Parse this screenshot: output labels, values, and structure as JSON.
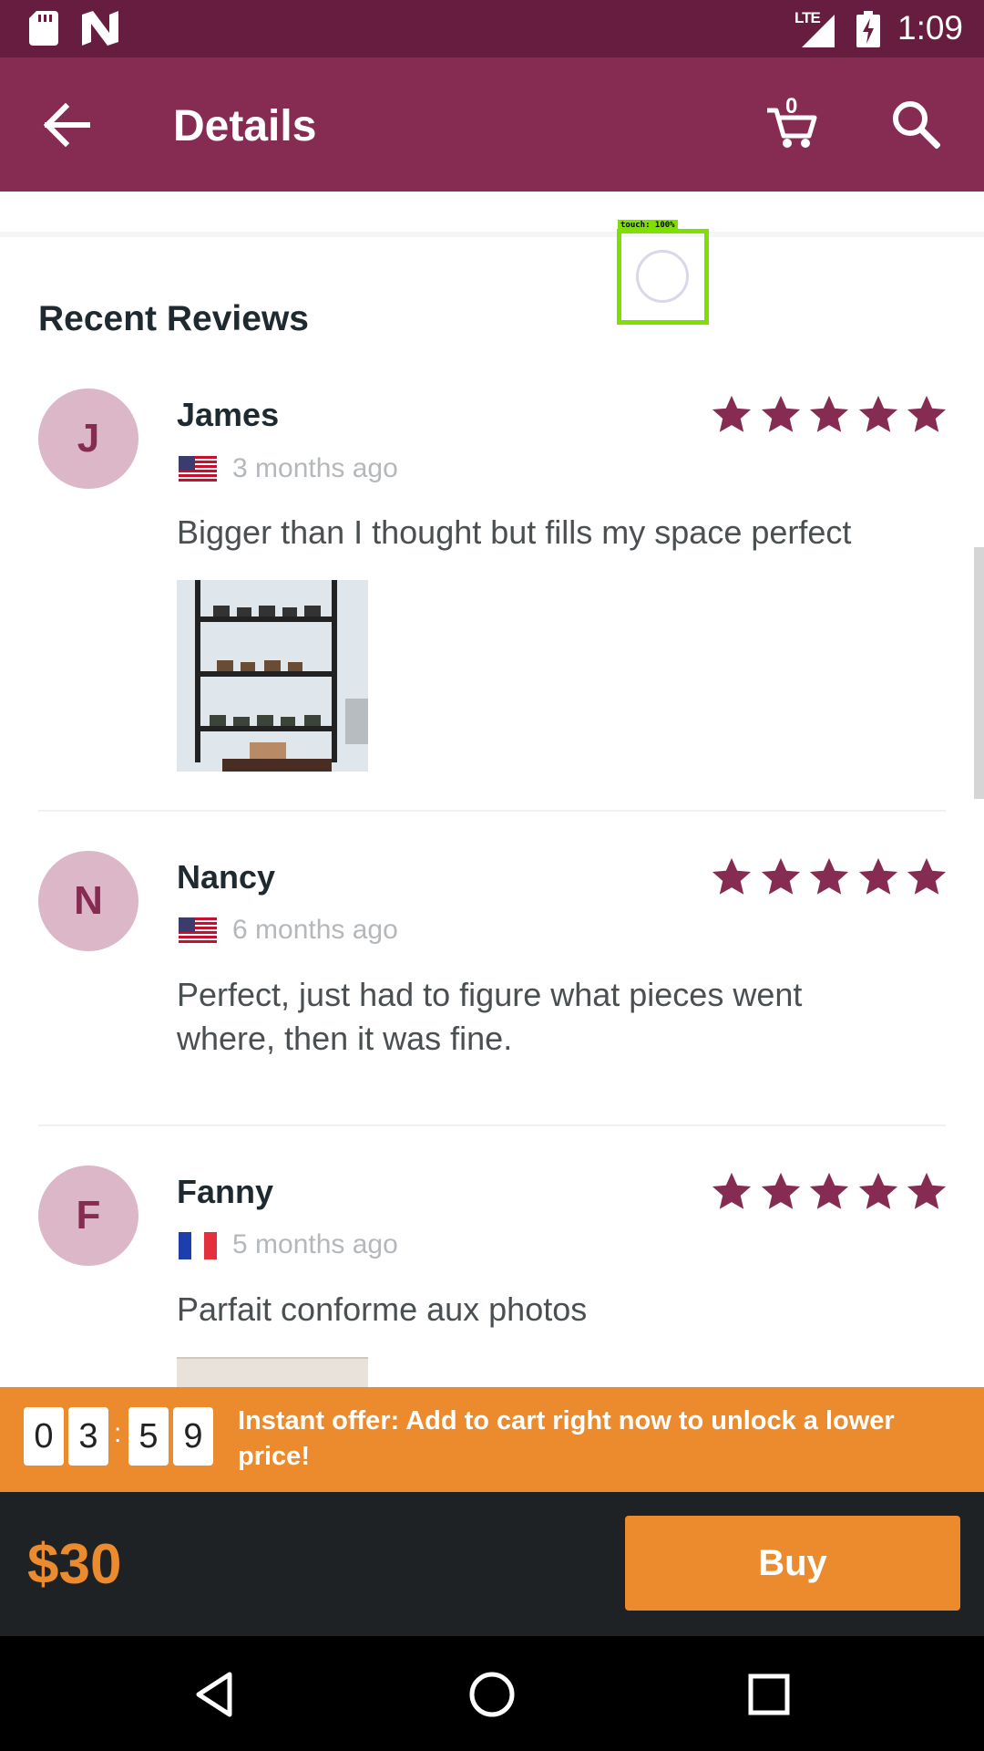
{
  "status_bar": {
    "time": "1:09",
    "network": "LTE"
  },
  "app_bar": {
    "title": "Details",
    "cart_count": "0"
  },
  "touch_overlay": {
    "label": "touch: 100%"
  },
  "reviews_section": {
    "title": "Recent Reviews",
    "reviews": [
      {
        "initial": "J",
        "name": "James",
        "time": "3 months ago",
        "country_flag": "us-flag-icon",
        "rating": 5,
        "text": "Bigger than I thought but fills my space perfect",
        "has_photo": true
      },
      {
        "initial": "N",
        "name": "Nancy",
        "time": "6 months ago",
        "country_flag": "us-flag-icon",
        "rating": 5,
        "text": "Perfect, just had to figure what pieces went where, then it was fine.",
        "has_photo": false
      },
      {
        "initial": "F",
        "name": "Fanny",
        "time": "5 months ago",
        "country_flag": "fr-flag-icon",
        "rating": 5,
        "text": "Parfait conforme aux photos",
        "has_photo": true
      }
    ]
  },
  "offer": {
    "timer_digits": [
      "0",
      "3",
      "5",
      "9"
    ],
    "separator": ":",
    "text": "Instant offer: Add to cart right now to unlock a lower price!"
  },
  "buy_bar": {
    "price": "$30",
    "buy_label": "Buy"
  },
  "colors": {
    "primary": "#862c52",
    "primary_dark": "#661d3f",
    "accent": "#ec8b2d",
    "star": "#862c52"
  }
}
